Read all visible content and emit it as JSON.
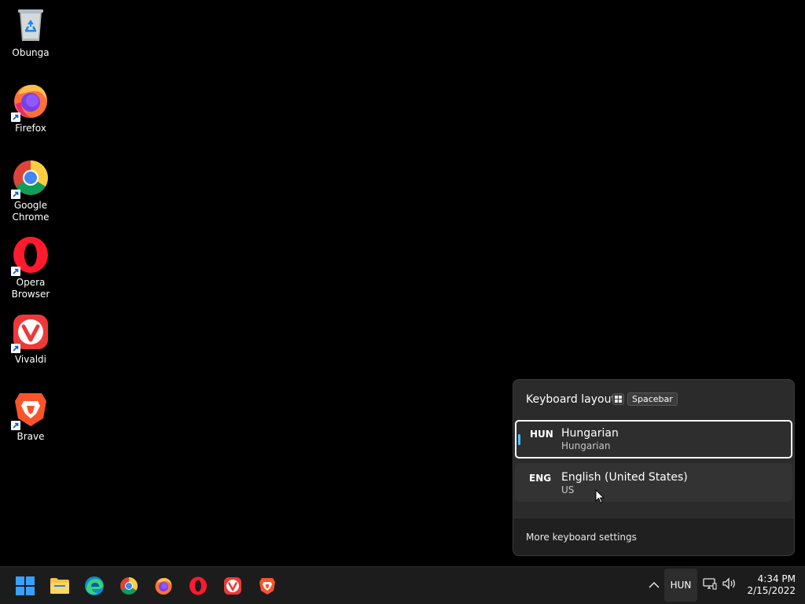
{
  "desktop": {
    "icons": [
      {
        "label": "Obunga",
        "icon": "recycle-bin-icon"
      },
      {
        "label": "Firefox",
        "icon": "firefox-icon"
      },
      {
        "label": "Google Chrome",
        "icon": "chrome-icon"
      },
      {
        "label": "Opera Browser",
        "icon": "opera-icon"
      },
      {
        "label": "Vivaldi",
        "icon": "vivaldi-icon"
      },
      {
        "label": "Brave",
        "icon": "brave-icon"
      }
    ]
  },
  "flyout": {
    "title": "Keyboard layout",
    "shortcut_windows_key": "windows-key-icon",
    "shortcut_key": "Spacebar",
    "items": [
      {
        "code": "HUN",
        "name": "Hungarian",
        "layout": "Hungarian",
        "selected": true
      },
      {
        "code": "ENG",
        "name": "English (United States)",
        "layout": "US",
        "selected": false
      }
    ],
    "footer_link": "More keyboard settings"
  },
  "taskbar": {
    "apps": [
      "start-icon",
      "file-explorer-icon",
      "edge-icon",
      "chrome-icon",
      "firefox-icon",
      "opera-icon",
      "vivaldi-icon",
      "brave-icon"
    ],
    "input_indicator": "HUN",
    "time": "4:34 PM",
    "date": "2/15/2022"
  },
  "colors": {
    "accent": "#4cc2ff",
    "flyout_bg": "#2b2b2b",
    "taskbar_bg": "#1c1c1c"
  }
}
